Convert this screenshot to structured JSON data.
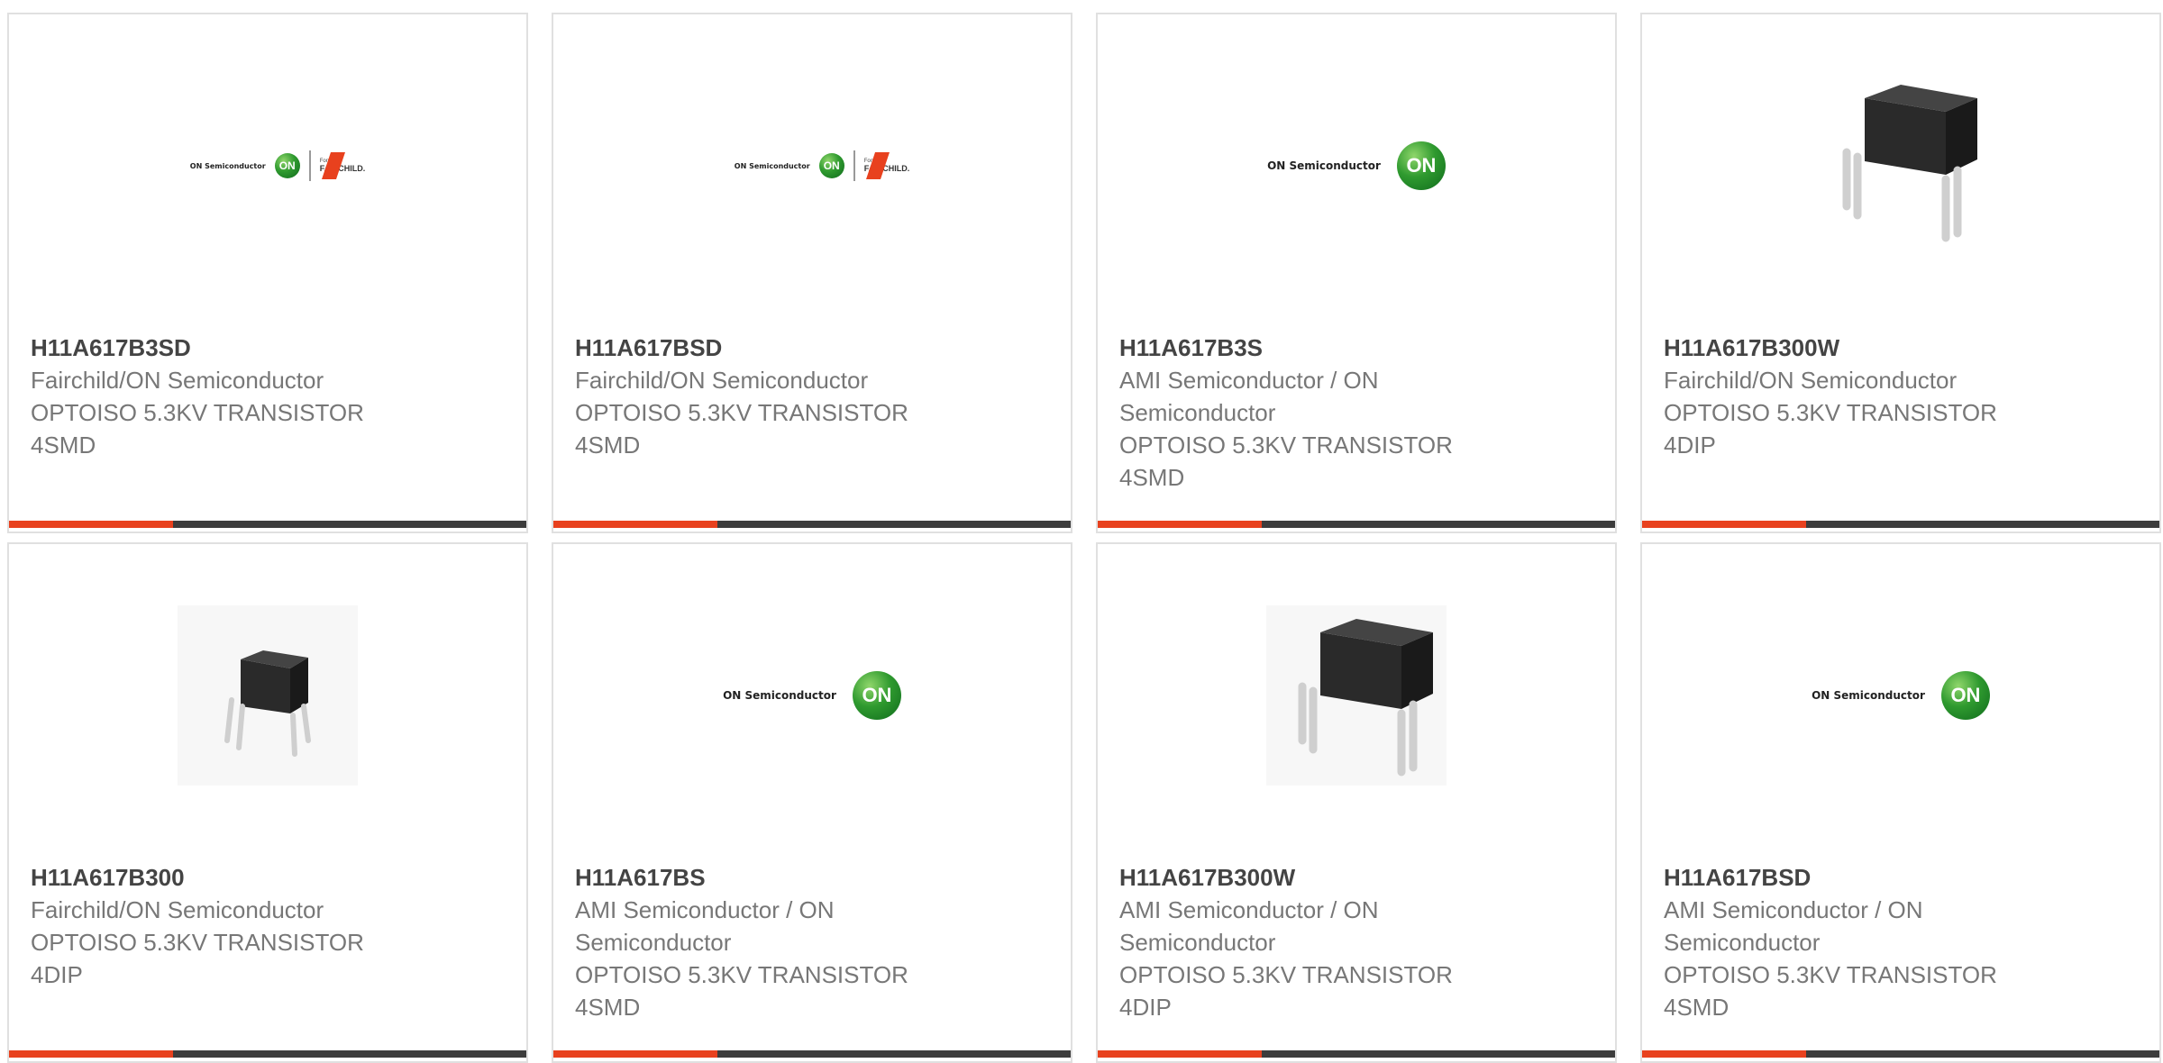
{
  "logos": {
    "on_semi_text": "ON Semiconductor",
    "on_badge_text": "ON",
    "formerly_text": "Formerly",
    "fairchild_text": "FAIRCHILD."
  },
  "cards": [
    {
      "part": "H11A617B3SD",
      "maker": "Fairchild/ON Semiconductor",
      "desc": "OPTOISO 5.3KV TRANSISTOR",
      "pkg": "4SMD",
      "image": "on-fairchild-logo"
    },
    {
      "part": "H11A617BSD",
      "maker": "Fairchild/ON Semiconductor",
      "desc": "OPTOISO 5.3KV TRANSISTOR",
      "pkg": "4SMD",
      "image": "on-fairchild-logo"
    },
    {
      "part": "H11A617B3S",
      "maker": "AMI Semiconductor / ON Semiconductor",
      "desc": "OPTOISO 5.3KV TRANSISTOR",
      "pkg": "4SMD",
      "image": "on-semiconductor-logo"
    },
    {
      "part": "H11A617B300W",
      "maker": "Fairchild/ON Semiconductor",
      "desc": "OPTOISO 5.3KV TRANSISTOR",
      "pkg": "4DIP",
      "image": "dip-chip-photo"
    },
    {
      "part": "H11A617B300",
      "maker": "Fairchild/ON Semiconductor",
      "desc": "OPTOISO 5.3KV TRANSISTOR",
      "pkg": "4DIP",
      "image": "small-dip-chip-photo"
    },
    {
      "part": "H11A617BS",
      "maker": "AMI Semiconductor / ON Semiconductor",
      "desc": "OPTOISO 5.3KV TRANSISTOR",
      "pkg": "4SMD",
      "image": "on-semiconductor-logo"
    },
    {
      "part": "H11A617B300W",
      "maker": "AMI Semiconductor / ON Semiconductor",
      "desc": "OPTOISO 5.3KV TRANSISTOR",
      "pkg": "4DIP",
      "image": "dip-chip-photo"
    },
    {
      "part": "H11A617BSD",
      "maker": "AMI Semiconductor / ON Semiconductor",
      "desc": "OPTOISO 5.3KV TRANSISTOR",
      "pkg": "4SMD",
      "image": "on-semiconductor-logo"
    }
  ],
  "colors": {
    "accent": "#e8411e",
    "bar": "#3c3c3c",
    "border": "#e0e0e0"
  }
}
